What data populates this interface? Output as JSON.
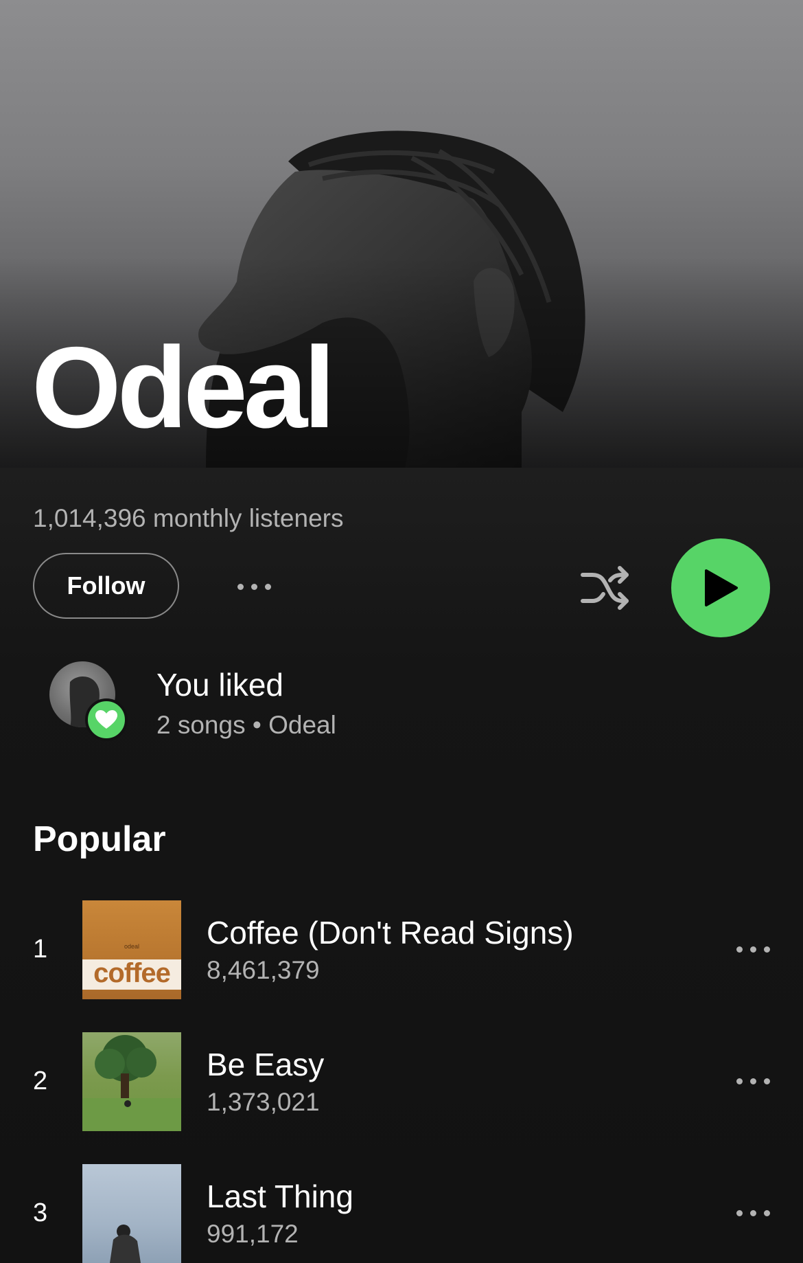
{
  "artist": {
    "name": "Odeal",
    "monthly_listeners": "1,014,396 monthly listeners"
  },
  "actions": {
    "follow_label": "Follow",
    "more_icon": "more-horizontal-icon",
    "shuffle_icon": "shuffle-icon",
    "play_icon": "play-icon"
  },
  "liked": {
    "title": "You liked",
    "subtitle": "2 songs • Odeal"
  },
  "popular": {
    "heading": "Popular",
    "tracks": [
      {
        "rank": "1",
        "title": "Coffee (Don't Read Signs)",
        "plays": "8,461,379",
        "art_text": "coffee",
        "art_small": "odeal"
      },
      {
        "rank": "2",
        "title": "Be Easy",
        "plays": "1,373,021"
      },
      {
        "rank": "3",
        "title": "Last Thing",
        "plays": "991,172"
      }
    ]
  },
  "colors": {
    "background": "#121212",
    "accent_green": "#57d467",
    "muted_text": "#b3b3b3"
  }
}
